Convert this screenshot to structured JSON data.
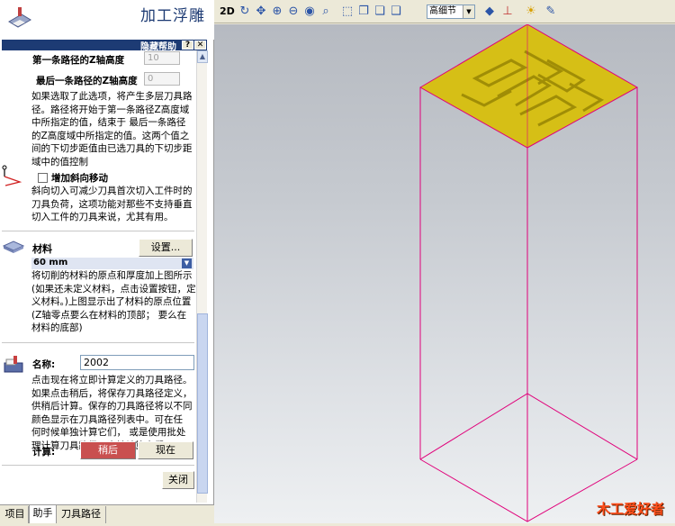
{
  "app": {
    "title": "加工浮雕"
  },
  "help_bar": {
    "label": "隐藏帮助",
    "help_btn": "?",
    "close_btn": "✕"
  },
  "z_first": {
    "label": "第一条路径的Z轴高度",
    "value": "10"
  },
  "z_last": {
    "label": "最后一条路径的Z轴高度",
    "value": "0"
  },
  "multi_pass_help": [
    "如果选取了此选项，将产生多层刀具路",
    "径。路径将开始于第一条路径Z高度域",
    "中所指定的值，结束于 最后一条路径",
    "的Z高度域中所指定的值。这两个值之",
    "间的下切步距值由已选刀具的下切步距",
    "域中的值控制"
  ],
  "ramp": {
    "checkbox_label": "增加斜向移动",
    "checked": false,
    "help": [
      "斜向切入可减少刀具首次切入工件时的",
      "刀具负荷，这项功能对那些不支持垂直",
      "切入工件的刀具来说，尤其有用。"
    ]
  },
  "material": {
    "label": "材料",
    "setup_button": "设置...",
    "value": "60 mm",
    "help": [
      "将切削的材料的原点和厚度加上图所示",
      "(如果还未定义材料，点击设置按钮，定",
      "义材料。)上图显示出了材料的原点位置",
      "(Z轴零点要么在材料的顶部； 要么在",
      "材料的底部)"
    ]
  },
  "name": {
    "label": "名称:",
    "value": "2002",
    "help": [
      "点击现在将立即计算定义的刀具路径。",
      "如果点击稍后，将保存刀具路径定义，",
      "供稍后计算。保存的刀具路径将以不同",
      "颜色显示在刀具路径列表中。可在任",
      "何时候单独计算它们， 或是使用批处",
      "理计算刀具路径一次性计算它们。"
    ]
  },
  "calculate": {
    "label": "计算:",
    "later_button": "稍后",
    "now_button": "现在"
  },
  "close_button": "关闭",
  "tabs": [
    "项目",
    "助手",
    "刀具路径"
  ],
  "toolbar": {
    "mode_2d": "2D",
    "detail_select": "高细节",
    "detail_options": [
      "高细节"
    ]
  },
  "watermark": "木工爱好者",
  "colors": {
    "accent": "#1d3b74",
    "wireframe": "#e0007a",
    "relief": "#d8c010",
    "later_button": "#c9504f"
  }
}
